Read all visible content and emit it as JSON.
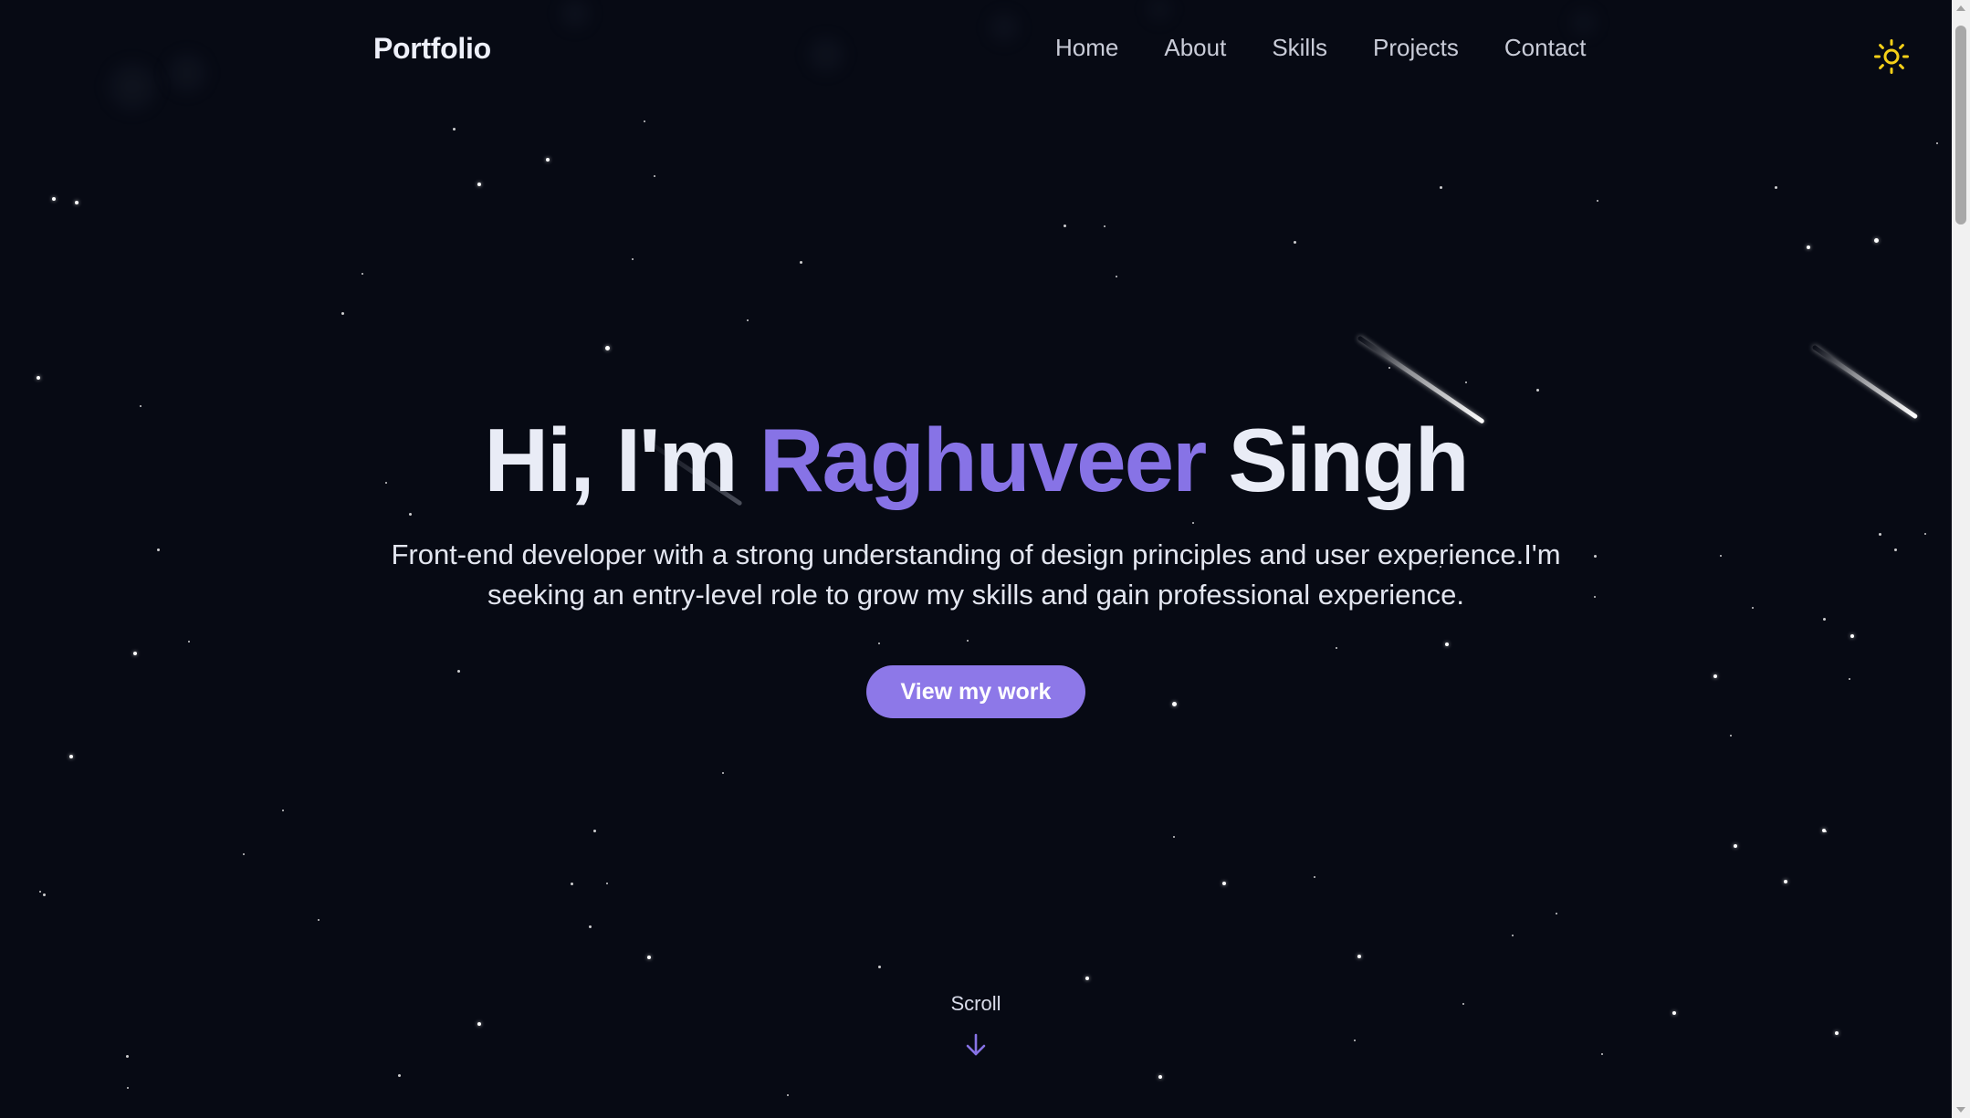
{
  "nav": {
    "brand": "Portfolio",
    "links": [
      "Home",
      "About",
      "Skills",
      "Projects",
      "Contact"
    ],
    "theme_icon": "sun-icon"
  },
  "hero": {
    "greeting": "Hi, I'm",
    "first_name": "Raghuveer",
    "last_name": "Singh",
    "subtitle": "Front-end developer with a strong understanding of design principles and user experience.I'm seeking an entry-level role to grow my skills and gain professional experience.",
    "cta_label": "View my work",
    "scroll_label": "Scroll",
    "scroll_icon": "arrow-down-icon"
  },
  "colors": {
    "background": "#070a14",
    "accent": "#8773e6",
    "button": "#8d78e8",
    "sun": "#f5d018"
  }
}
